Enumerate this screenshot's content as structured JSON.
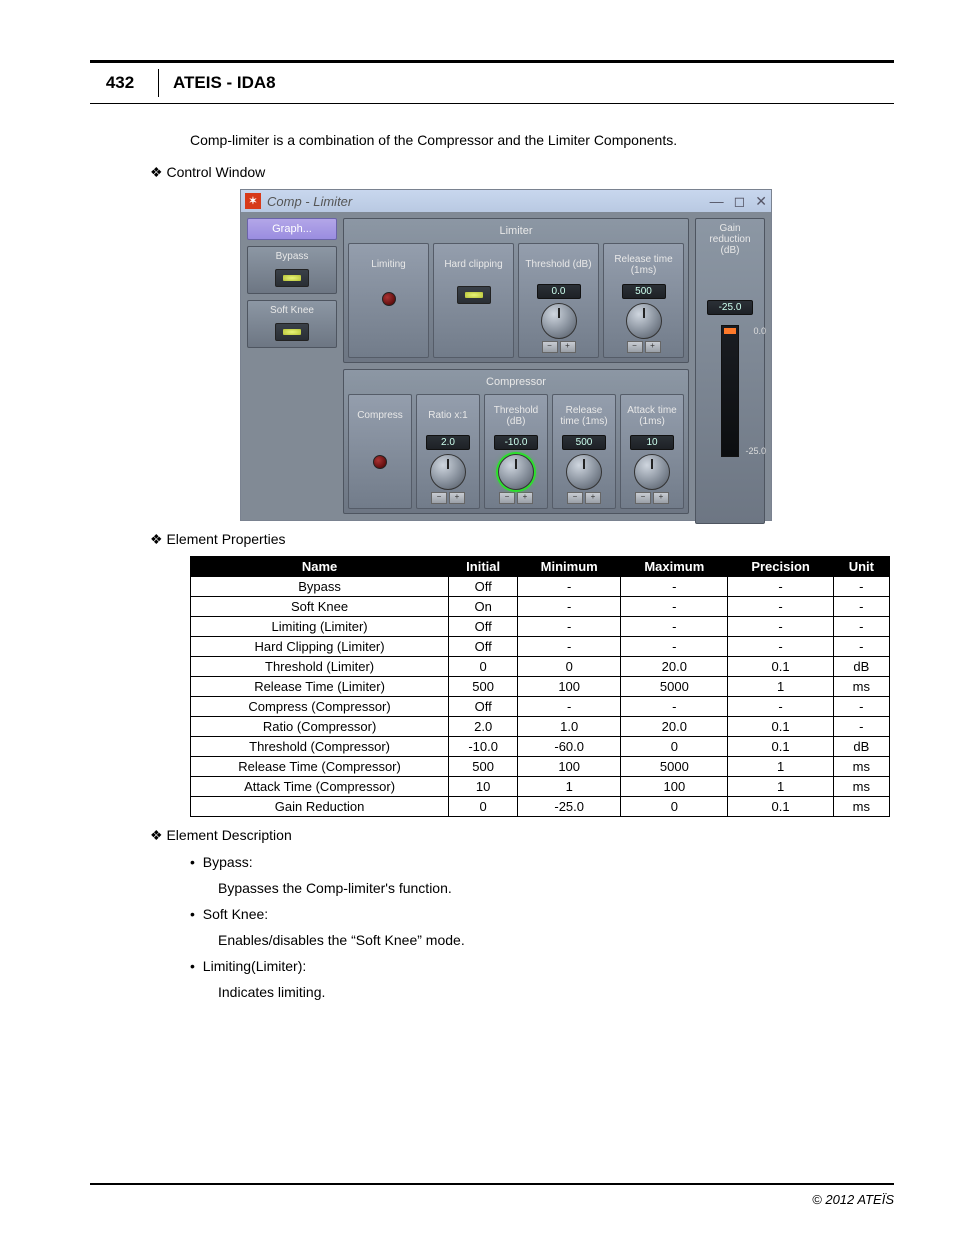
{
  "header": {
    "page_number": "432",
    "title": "ATEIS - IDA8"
  },
  "intro": "Comp-limiter  is a combination of the Compressor and the Limiter Components.",
  "sections": {
    "control_window": "Control Window",
    "element_properties": "Element Properties",
    "element_description": "Element Description"
  },
  "window": {
    "title": "Comp - Limiter",
    "graph_btn": "Graph...",
    "left": {
      "bypass": "Bypass",
      "soft_knee": "Soft Knee"
    },
    "limiter": {
      "title": "Limiter",
      "limiting": "Limiting",
      "hard_clipping": "Hard\nclipping",
      "threshold": {
        "label": "Threshold\n(dB)",
        "value": "0.0"
      },
      "release": {
        "label": "Release\ntime\n(1ms)",
        "value": "500"
      }
    },
    "compressor": {
      "title": "Compressor",
      "compress": "Compress",
      "ratio": {
        "label": "Ratio\nx:1",
        "value": "2.0"
      },
      "threshold": {
        "label": "Threshold\n(dB)",
        "value": "-10.0"
      },
      "release": {
        "label": "Release\ntime\n(1ms)",
        "value": "500"
      },
      "attack": {
        "label": "Attack\ntime\n(1ms)",
        "value": "10"
      }
    },
    "gain": {
      "label": "Gain\nreduction\n(dB)",
      "value": "-25.0",
      "scale_top": "0.0",
      "scale_bot": "-25.0"
    }
  },
  "table": {
    "headers": [
      "Name",
      "Initial",
      "Minimum",
      "Maximum",
      "Precision",
      "Unit"
    ],
    "rows": [
      [
        "Bypass",
        "Off",
        "-",
        "-",
        "-",
        "-"
      ],
      [
        "Soft Knee",
        "On",
        "-",
        "-",
        "-",
        "-"
      ],
      [
        "Limiting (Limiter)",
        "Off",
        "-",
        "-",
        "-",
        "-"
      ],
      [
        "Hard Clipping (Limiter)",
        "Off",
        "-",
        "-",
        "-",
        "-"
      ],
      [
        "Threshold (Limiter)",
        "0",
        "0",
        "20.0",
        "0.1",
        "dB"
      ],
      [
        "Release Time (Limiter)",
        "500",
        "100",
        "5000",
        "1",
        "ms"
      ],
      [
        "Compress (Compressor)",
        "Off",
        "-",
        "-",
        "-",
        "-"
      ],
      [
        "Ratio (Compressor)",
        "2.0",
        "1.0",
        "20.0",
        "0.1",
        "-"
      ],
      [
        "Threshold (Compressor)",
        "-10.0",
        "-60.0",
        "0",
        "0.1",
        "dB"
      ],
      [
        "Release Time (Compressor)",
        "500",
        "100",
        "5000",
        "1",
        "ms"
      ],
      [
        "Attack Time (Compressor)",
        "10",
        "1",
        "100",
        "1",
        "ms"
      ],
      [
        "Gain Reduction",
        "0",
        "-25.0",
        "0",
        "0.1",
        "ms"
      ]
    ]
  },
  "descriptions": [
    {
      "term": "Bypass:",
      "text": "Bypasses the Comp-limiter's function."
    },
    {
      "term": "Soft Knee:",
      "text": "Enables/disables the “Soft Knee” mode."
    },
    {
      "term": "Limiting(Limiter):",
      "text": "Indicates limiting."
    }
  ],
  "footer": "© 2012 ATEÏS"
}
